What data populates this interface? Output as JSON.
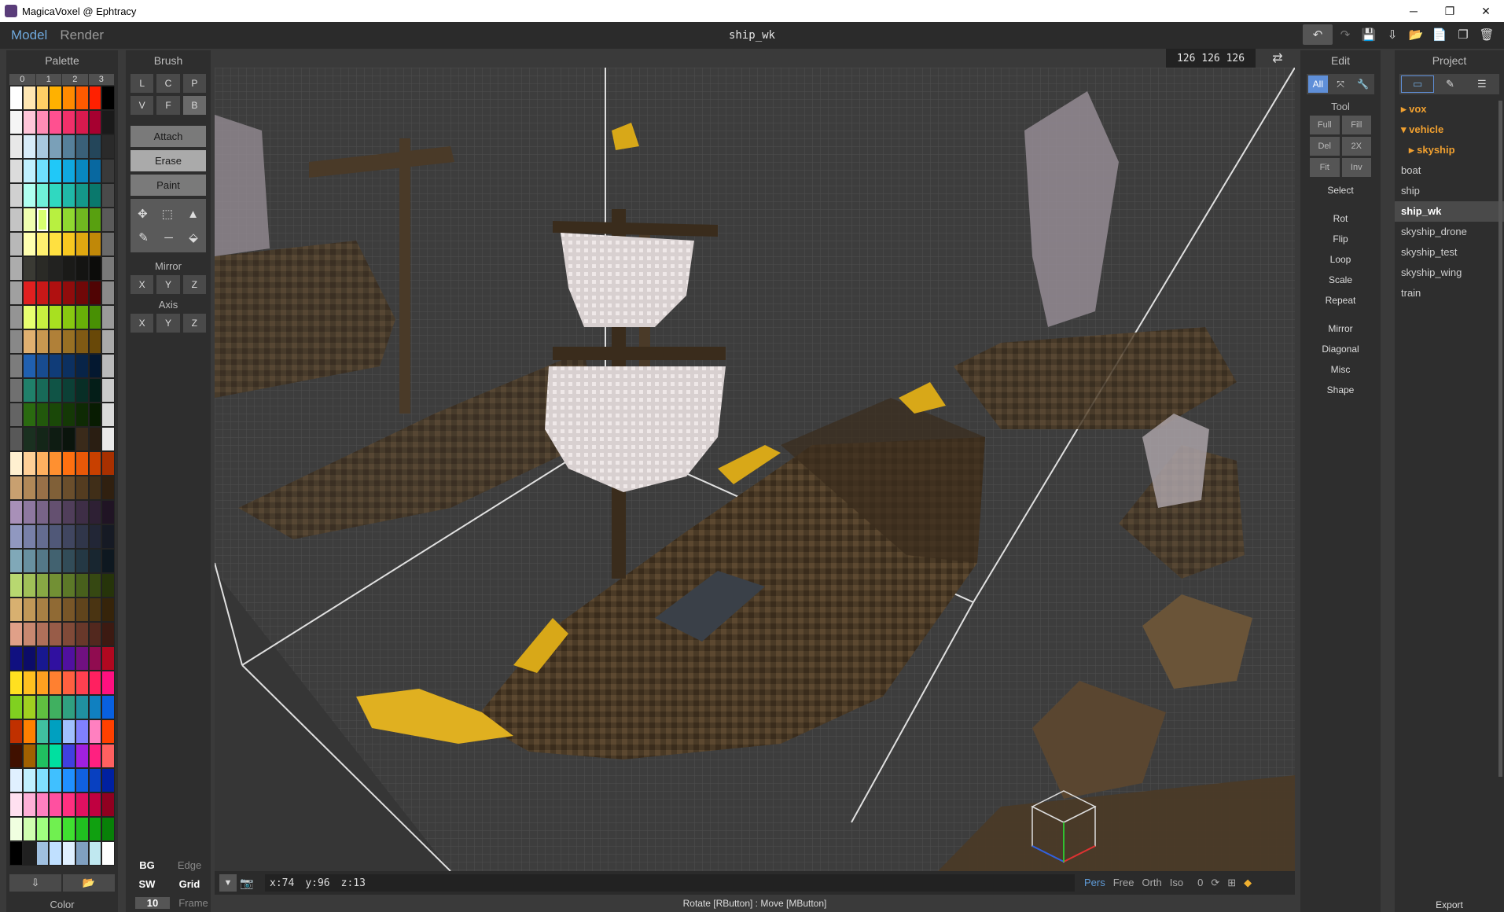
{
  "window": {
    "title": "MagicaVoxel @ Ephtracy",
    "minimize": "─",
    "maximize": "❐",
    "close": "✕"
  },
  "menu": {
    "model": "Model",
    "render": "Render",
    "filename": "ship_wk"
  },
  "toolbar": {
    "undo": "↶",
    "redo": "↷",
    "save": "💾",
    "export": "⇩",
    "open": "📂",
    "new": "📄",
    "copy": "❐",
    "delete": "🗑"
  },
  "palette": {
    "title": "Palette",
    "cols": [
      "0",
      "1",
      "2",
      "3"
    ],
    "colors": [
      "#ffffff",
      "#ffe7b3",
      "#ffd066",
      "#ffb100",
      "#ff8a00",
      "#ff5a00",
      "#ff2000",
      "#000000",
      "#f5f5f5",
      "#ffc6d9",
      "#ff8cb5",
      "#ff5090",
      "#f0306a",
      "#d81a4e",
      "#a60030",
      "#1a1a1a",
      "#e8e8e8",
      "#d8ecf8",
      "#a8c8de",
      "#7aa0b8",
      "#56809a",
      "#3a6078",
      "#24465a",
      "#2a2a2a",
      "#dcdcdc",
      "#c0f0ff",
      "#70e0ff",
      "#20c8f8",
      "#10a8e0",
      "#0888c0",
      "#0868a0",
      "#3a3a3a",
      "#d0d0d0",
      "#b0fff0",
      "#70f0d8",
      "#30d8c0",
      "#20b8a8",
      "#14988a",
      "#0a786c",
      "#4a4a4a",
      "#c4c4c4",
      "#f0ffb0",
      "#d8ff70",
      "#b8f040",
      "#90d830",
      "#70b820",
      "#58a010",
      "#5a5a5a",
      "#b8b8b8",
      "#ffffb0",
      "#fff070",
      "#ffe040",
      "#f8c820",
      "#e0a810",
      "#c08808",
      "#6a6a6a",
      "#acacac",
      "#3a3a34",
      "#2a2a26",
      "#222220",
      "#1a1a18",
      "#141412",
      "#0c0c0a",
      "#7a7a7a",
      "#a0a0a0",
      "#e02020",
      "#c81818",
      "#b01010",
      "#900c0c",
      "#700808",
      "#500404",
      "#8a8a8a",
      "#949494",
      "#e8ff70",
      "#c8f040",
      "#a8e020",
      "#88c810",
      "#68b008",
      "#489004",
      "#9a9a9a",
      "#888888",
      "#e0b070",
      "#c89850",
      "#b08038",
      "#987024",
      "#805a14",
      "#684808",
      "#aaaaaa",
      "#7c7c7c",
      "#2060b0",
      "#184c90",
      "#103c78",
      "#0c3060",
      "#082448",
      "#041830",
      "#bababa",
      "#707070",
      "#20806a",
      "#186a58",
      "#105446",
      "#0c4036",
      "#082e26",
      "#041e18",
      "#cacaca",
      "#646464",
      "#2a6a10",
      "#22580c",
      "#1a4808",
      "#143806",
      "#0e2a04",
      "#081c02",
      "#dadada",
      "#585858",
      "#1a3020",
      "#142618",
      "#0e1c12",
      "#0a140c",
      "#3a2a1a",
      "#2a1e12",
      "#eaeaea",
      "#fff0d0",
      "#ffd098",
      "#ffb060",
      "#ff9030",
      "#ff7010",
      "#e85808",
      "#c84000",
      "#a83000",
      "#c8a070",
      "#b08858",
      "#987048",
      "#806038",
      "#6a4e2c",
      "#543c20",
      "#402e18",
      "#302010",
      "#a890b8",
      "#8e78a0",
      "#786488",
      "#645070",
      "#503e5a",
      "#3e2e46",
      "#2e2034",
      "#201424",
      "#9098c0",
      "#7880a8",
      "#646c90",
      "#505878",
      "#404660",
      "#30364a",
      "#222636",
      "#161a24",
      "#80a8b8",
      "#6890a0",
      "#547888",
      "#426270",
      "#324c58",
      "#243844",
      "#182630",
      "#0e1820",
      "#b8d870",
      "#a0c058",
      "#88a844",
      "#729034",
      "#5c7828",
      "#48601c",
      "#364812",
      "#26340a",
      "#d8b070",
      "#c09858",
      "#a88044",
      "#906a34",
      "#785628",
      "#60441c",
      "#4a3412",
      "#36240a",
      "#e0a088",
      "#c88870",
      "#b0705a",
      "#985c48",
      "#804a38",
      "#68382a",
      "#52281e",
      "#3c1a12",
      "#101080",
      "#0c0c68",
      "#181890",
      "#3010a0",
      "#5010a0",
      "#701080",
      "#900c50",
      "#b00820",
      "#ffe020",
      "#ffc020",
      "#ffa020",
      "#ff8030",
      "#ff6040",
      "#ff4050",
      "#ff2060",
      "#ff1080",
      "#80d020",
      "#a0d020",
      "#60c040",
      "#40b060",
      "#30a080",
      "#2090a0",
      "#1080c0",
      "#0860e0",
      "#c03000",
      "#ff8000",
      "#40c0a0",
      "#00a0c0",
      "#a0c0ff",
      "#8080ff",
      "#ff80c0",
      "#ff4000",
      "#401000",
      "#a06000",
      "#20c060",
      "#00e0a0",
      "#4040e0",
      "#a020e0",
      "#ff2080",
      "#ff6060",
      "#e0f0ff",
      "#c0f0ff",
      "#80e0ff",
      "#40c0ff",
      "#2090ff",
      "#1060e0",
      "#0840c0",
      "#0020a0",
      "#ffe0f0",
      "#ffb0d8",
      "#ff80c0",
      "#ff50a0",
      "#ff3080",
      "#e01060",
      "#c00040",
      "#900020",
      "#f0ffe0",
      "#d0ffb0",
      "#a0ff80",
      "#70f050",
      "#40e030",
      "#20c020",
      "#10a010",
      "#088008",
      "#000000",
      "#202020",
      "#a0c0e0",
      "#c0e0ff",
      "#e0f0ff",
      "#80a0c0",
      "#c0e8f0",
      "#ffffff"
    ],
    "selected_index": 42,
    "import_icon": "⇩",
    "folder_icon": "📂",
    "footer": "Color"
  },
  "brush": {
    "title": "Brush",
    "shapes1": [
      "L",
      "C",
      "P"
    ],
    "shapes2": [
      "V",
      "F",
      "B"
    ],
    "attach": "Attach",
    "erase": "Erase",
    "paint": "Paint",
    "tools1": [
      "✥",
      "⬚",
      "▲"
    ],
    "tools2": [
      "✎",
      "─",
      "⬙"
    ],
    "mirror_label": "Mirror",
    "mirror": [
      "X",
      "Y",
      "Z"
    ],
    "axis_label": "Axis",
    "axis": [
      "X",
      "Y",
      "Z"
    ],
    "bottom": {
      "bg": "BG",
      "edge": "Edge",
      "sw": "SW",
      "grid": "Grid",
      "frame_num": "10",
      "frame": "Frame"
    }
  },
  "viewport": {
    "size": "126 126 126",
    "swap_icon": "⇄",
    "coords": {
      "x": "x:74",
      "y": "y:96",
      "z": "z:13"
    },
    "views": [
      "Pers",
      "Free",
      "Orth",
      "Iso"
    ],
    "zero": "0",
    "hint": "Rotate [RButton] : Move [MButton]"
  },
  "edit": {
    "title": "Edit",
    "modes": [
      "All",
      "⤧",
      "🔧"
    ],
    "tool_label": "Tool",
    "tool_grid": [
      "Full",
      "Fill",
      "Del",
      "2X",
      "Fit",
      "Inv"
    ],
    "select": "Select",
    "ops": [
      "Rot",
      "Flip",
      "Loop",
      "Scale",
      "Repeat"
    ],
    "ops2": [
      "Mirror",
      "Diagonal",
      "Misc",
      "Shape"
    ]
  },
  "project": {
    "title": "Project",
    "tabs": [
      "▭",
      "✎",
      "☰"
    ],
    "items": [
      {
        "label": "vox",
        "kind": "folder"
      },
      {
        "label": "vehicle",
        "kind": "folder-open"
      },
      {
        "label": "skyship",
        "kind": "subfolder"
      },
      {
        "label": "boat",
        "kind": "file"
      },
      {
        "label": "ship",
        "kind": "file"
      },
      {
        "label": "ship_wk",
        "kind": "selected"
      },
      {
        "label": "skyship_drone",
        "kind": "file"
      },
      {
        "label": "skyship_test",
        "kind": "file"
      },
      {
        "label": "skyship_wing",
        "kind": "file"
      },
      {
        "label": "train",
        "kind": "file"
      }
    ],
    "export": "Export"
  }
}
